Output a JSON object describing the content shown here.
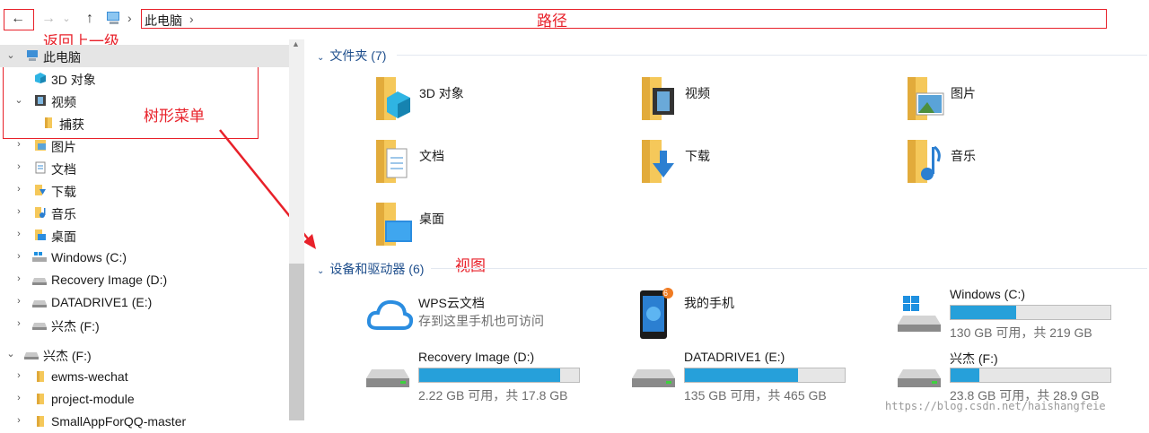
{
  "address": {
    "back_icon": "arrow-left-icon",
    "forward_icon": "arrow-right-icon",
    "recent_icon": "chevron-down-icon",
    "up_icon": "arrow-up-icon",
    "crumb": "此电脑",
    "crumb_sep": "›"
  },
  "annotations": {
    "path": "路径",
    "back": "返回上一级",
    "tree": "树形菜单",
    "view": "视图"
  },
  "tree": {
    "items": [
      {
        "label": "此电脑",
        "expanded": true
      },
      {
        "label": "3D 对象"
      },
      {
        "label": "视频",
        "expanded": true
      },
      {
        "label": "捕获"
      },
      {
        "label": "图片"
      },
      {
        "label": "文档"
      },
      {
        "label": "下载"
      },
      {
        "label": "音乐"
      },
      {
        "label": "桌面"
      },
      {
        "label": "Windows (C:)"
      },
      {
        "label": "Recovery Image (D:)"
      },
      {
        "label": "DATADRIVE1 (E:)"
      },
      {
        "label": "兴杰 (F:)"
      },
      {
        "label": "兴杰 (F:)",
        "expanded": true
      },
      {
        "label": "ewms-wechat"
      },
      {
        "label": "project-module"
      },
      {
        "label": "SmallAppForQQ-master"
      }
    ]
  },
  "content": {
    "folders_header": "文件夹 (7)",
    "folders": [
      {
        "label": "3D 对象"
      },
      {
        "label": "视频"
      },
      {
        "label": "图片"
      },
      {
        "label": "文档"
      },
      {
        "label": "下载"
      },
      {
        "label": "音乐"
      },
      {
        "label": "桌面"
      }
    ],
    "devices_header": "设备和驱动器 (6)",
    "devices": [
      {
        "name": "WPS云文档",
        "sub": "存到这里手机也可访问"
      },
      {
        "name": "我的手机",
        "badge": "6"
      },
      {
        "name": "Windows (C:)",
        "sub": "130 GB 可用，共 219 GB",
        "used_fraction": 0.41
      },
      {
        "name": "Recovery Image (D:)",
        "sub": "2.22 GB 可用，共 17.8 GB",
        "used_fraction": 0.88
      },
      {
        "name": "DATADRIVE1 (E:)",
        "sub": "135 GB 可用，共 465 GB",
        "used_fraction": 0.71
      },
      {
        "name": "兴杰 (F:)",
        "sub": "23.8 GB 可用，共 28.9 GB",
        "used_fraction": 0.18
      }
    ]
  },
  "watermark": "https://blog.csdn.net/haishangfeie",
  "colors": {
    "accent": "#26a0da",
    "annotation": "#e8212a",
    "folder": "#f5c85a",
    "section": "#1e4e8c"
  }
}
